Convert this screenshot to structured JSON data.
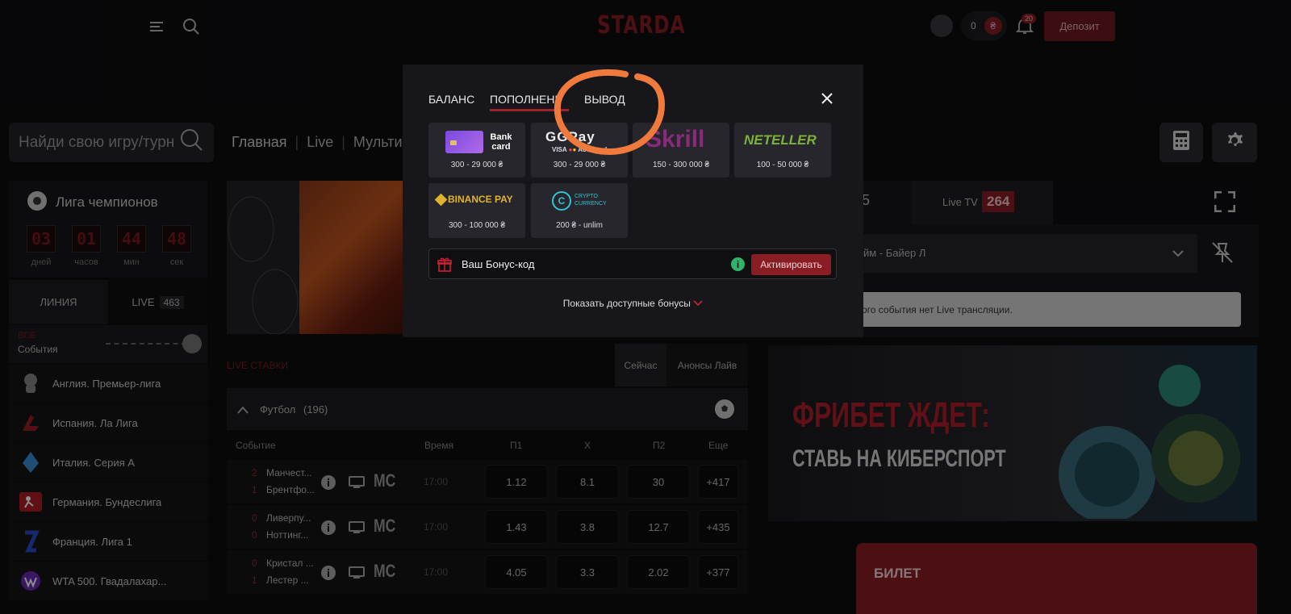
{
  "header": {
    "logo": "STARDA",
    "balance_value": "0",
    "currency_symbol": "₴",
    "notifications_count": "20",
    "deposit_label": "Депозит"
  },
  "search": {
    "placeholder": "Найди свою игру/турн"
  },
  "nav": {
    "items": [
      "Главная",
      "Live",
      "Мультив"
    ]
  },
  "sidebar": {
    "event_title": "Лига чемпионов",
    "countdown": [
      {
        "value": "03",
        "label": "дней"
      },
      {
        "value": "01",
        "label": "часов"
      },
      {
        "value": "44",
        "label": "мин"
      },
      {
        "value": "48",
        "label": "сек"
      }
    ],
    "tabs": {
      "line": "ЛИНИЯ",
      "live": "LIVE",
      "live_count": "463"
    },
    "filter_all": "ВСЕ",
    "filter_events": "События",
    "leagues": [
      "Англия. Премьер-лига",
      "Испания. Ла Лига",
      "Италия. Серия А",
      "Германия. Бундеслига",
      "Франция. Лига 1",
      "WTA 500. Гвадалахар..."
    ]
  },
  "live": {
    "title": "LIVE СТАВКИ",
    "tab_now": "Сейчас",
    "tab_announce": "Анонсы Лайв",
    "sport": "Футбол",
    "sport_count": "(196)",
    "columns": [
      "Событие",
      "Время",
      "П1",
      "X",
      "П2",
      "Еще"
    ],
    "matches": [
      {
        "s1": "2",
        "s2": "1",
        "t1": "Манчест...",
        "t2": "Брентфо...",
        "time": "17:00",
        "p1": "1.12",
        "x": "8.1",
        "p2": "30",
        "more": "+417"
      },
      {
        "s1": "0",
        "s2": "0",
        "t1": "Ливерпу...",
        "t2": "Ноттинг...",
        "time": "17:00",
        "p1": "1.43",
        "x": "3.8",
        "p2": "12.7",
        "more": "+435"
      },
      {
        "s1": "0",
        "s2": "1",
        "t1": "Кристал ...",
        "t2": "Лестер ...",
        "time": "17:00",
        "p1": "4.05",
        "x": "3.3",
        "p2": "2.02",
        "more": "+377"
      }
    ],
    "league_badge": "MC"
  },
  "right": {
    "tab_partial": "5",
    "live_tv": "Live TV",
    "live_tv_count": "264",
    "select_text": "йм - Байер Л",
    "notice": "ого события нет Live трансляции.",
    "promo_line1": "ФРИБЕТ ЖДЕТ:",
    "promo_line2": "СТАВЬ НА КИБЕРСПОРТ",
    "ticket": "БИЛЕТ"
  },
  "modal": {
    "tab_balance": "БАЛАНС",
    "tab_deposit": "ПОПОЛНЕНИЕ",
    "tab_withdraw": "ВЫВОД",
    "methods": [
      {
        "name": "Bank card",
        "amount": "300 - 29 000 ₴"
      },
      {
        "name": "GGPay",
        "amount": "300 - 29 000 ₴"
      },
      {
        "name": "Skrill",
        "amount": "150 - 300 000 ₴"
      },
      {
        "name": "NETELLER",
        "amount": "100 - 50 000 ₴"
      },
      {
        "name": "BINANCE PAY",
        "amount": "300 - 100 000 ₴"
      },
      {
        "name": "CRYPTO CURRENCY",
        "amount": "200 ₴ - unlim"
      }
    ],
    "bonus_placeholder": "Ваш Бонус-код",
    "activate": "Активировать",
    "show_bonuses": "Показать доступные бонусы"
  },
  "colors": {
    "accent": "#8a1c24",
    "annotation": "#f07a3c"
  }
}
